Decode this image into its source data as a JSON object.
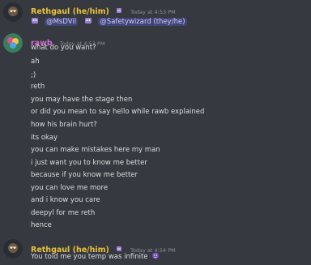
{
  "messages": [
    {
      "username": "Rethgaul (he/him)",
      "username_color": "#e8c33b",
      "timestamp": "Today at 4:53 PM",
      "mentions": [
        "@MsDVil",
        "@Safetywizard (they/he)"
      ]
    },
    {
      "username": "rawb",
      "username_color": "#d56ed8",
      "timestamp": "Today at 4:53 PM",
      "lines": [
        "what do you want?",
        "ah",
        ";)",
        "reth",
        "you may have the stage then",
        "or did you mean to say hello while rawb explained",
        "how his brain hurt?",
        "its okay",
        "you can make mistakes here my man",
        "i just want you to know me better",
        "because if you know me better",
        "you can love me more",
        "and i know you care",
        "deepyl for me reth",
        "hence"
      ]
    },
    {
      "username": "Rethgaul (he/him)",
      "username_color": "#e8c33b",
      "timestamp": "Today at 4:54 PM",
      "text": "You told me you temp was infinite"
    }
  ]
}
